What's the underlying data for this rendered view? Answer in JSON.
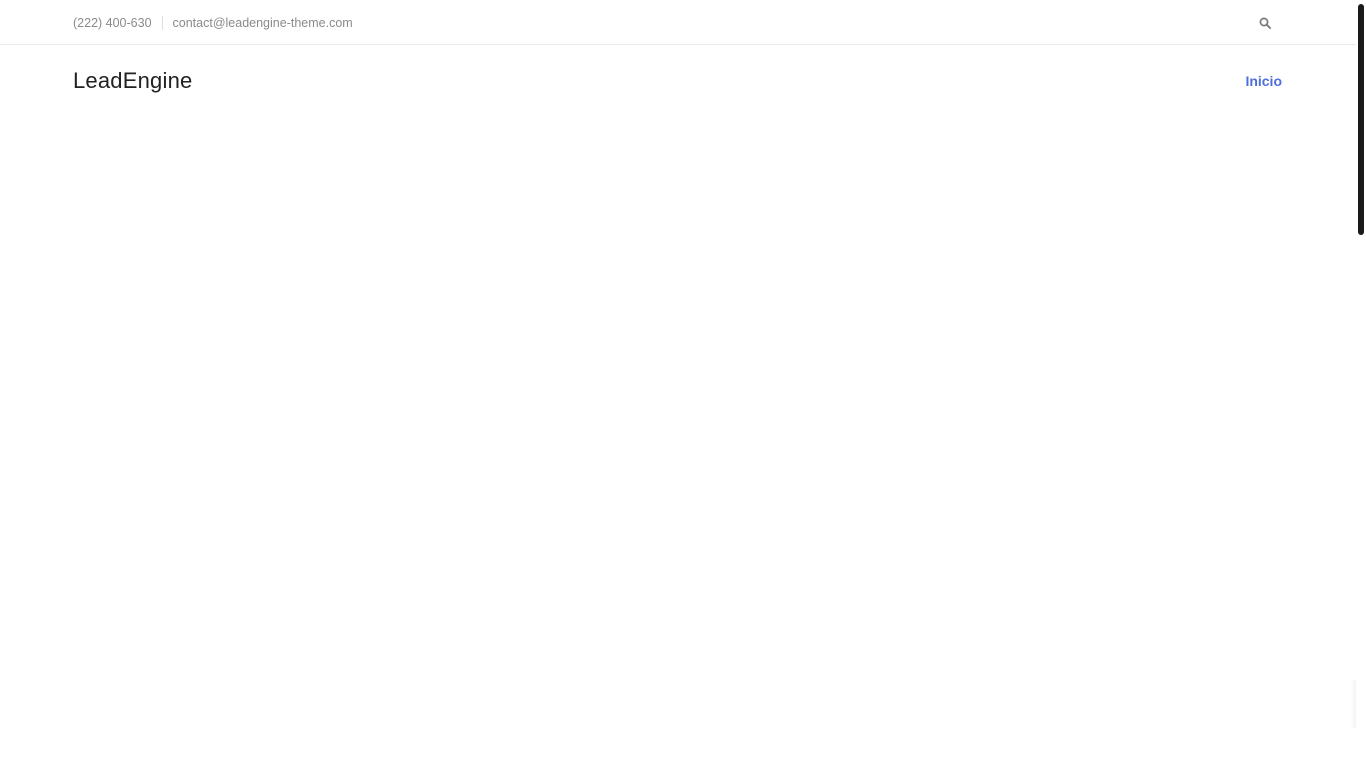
{
  "topbar": {
    "phone": "(222) 400-630",
    "email": "contact@leadengine-theme.com",
    "search_icon": "search-icon"
  },
  "header": {
    "logo_text": "LeadEngine",
    "nav": [
      {
        "label": "Inicio",
        "active": true
      }
    ]
  },
  "colors": {
    "accent": "#4f6edc",
    "topbar_text": "#8a8a8a",
    "logo_text": "#222222",
    "border": "#e9e9e9"
  }
}
